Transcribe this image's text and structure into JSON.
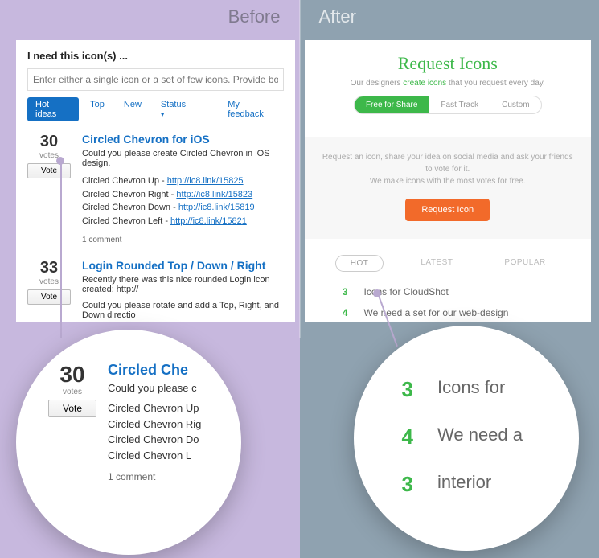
{
  "labels": {
    "before": "Before",
    "after": "After"
  },
  "before_panel": {
    "heading": "I need this icon(s) ...",
    "placeholder": "Enter either a single icon or a set of few icons. Provide bo",
    "tabs": [
      "Hot ideas",
      "Top",
      "New",
      "Status",
      "My feedback"
    ],
    "items": [
      {
        "votes": 30,
        "votes_label": "votes",
        "vote_btn": "Vote",
        "title": "Circled Chevron for iOS",
        "desc": "Could you please create Circled Chevron in iOS design.",
        "lines": [
          {
            "text": "Circled Chevron Up - ",
            "url": "http://ic8.link/15825"
          },
          {
            "text": "Circled Chevron Right - ",
            "url": "http://ic8.link/15823"
          },
          {
            "text": "Circled Chevron Down - ",
            "url": "http://ic8.link/15819"
          },
          {
            "text": "Circled Chevron Left - ",
            "url": "http://ic8.link/15821"
          }
        ],
        "comments": "1 comment"
      },
      {
        "votes": 33,
        "votes_label": "votes",
        "vote_btn": "Vote",
        "title": "Login Rounded Top / Down / Right",
        "desc": "Recently there was this nice rounded Login icon created: http://",
        "desc2": "Could you please rotate and add a Top, Right, and Down directio"
      }
    ]
  },
  "after_panel": {
    "title": "Request Icons",
    "subtitle_pre": "Our designers ",
    "subtitle_link": "create icons",
    "subtitle_post": " that you request every day.",
    "segments": [
      "Free for Share",
      "Fast Track",
      "Custom"
    ],
    "grey_line1": "Request an icon, share your idea on social media and ask your friends to vote for it.",
    "grey_line2": "We make icons with the most votes for free.",
    "request_btn": "Request Icon",
    "pills": [
      "HOT",
      "LATEST",
      "POPULAR"
    ],
    "list": [
      {
        "n": "3",
        "t": "Icons for CloudShot"
      },
      {
        "n": "4",
        "t": "We need a set for our web-design"
      }
    ]
  },
  "zoom_before": {
    "votes": 30,
    "votes_label": "votes",
    "vote_btn": "Vote",
    "title": "Circled Che",
    "desc": "Could you please c",
    "l1": "Circled Chevron Up",
    "l2": "Circled Chevron Rig",
    "l3": "Circled Chevron Do",
    "l4": "Circled Chevron L",
    "comments": "1 comment"
  },
  "zoom_after": {
    "rows": [
      {
        "n": "3",
        "t": "Icons for"
      },
      {
        "n": "4",
        "t": "We need a"
      },
      {
        "n": "3",
        "t": "interior"
      }
    ]
  }
}
